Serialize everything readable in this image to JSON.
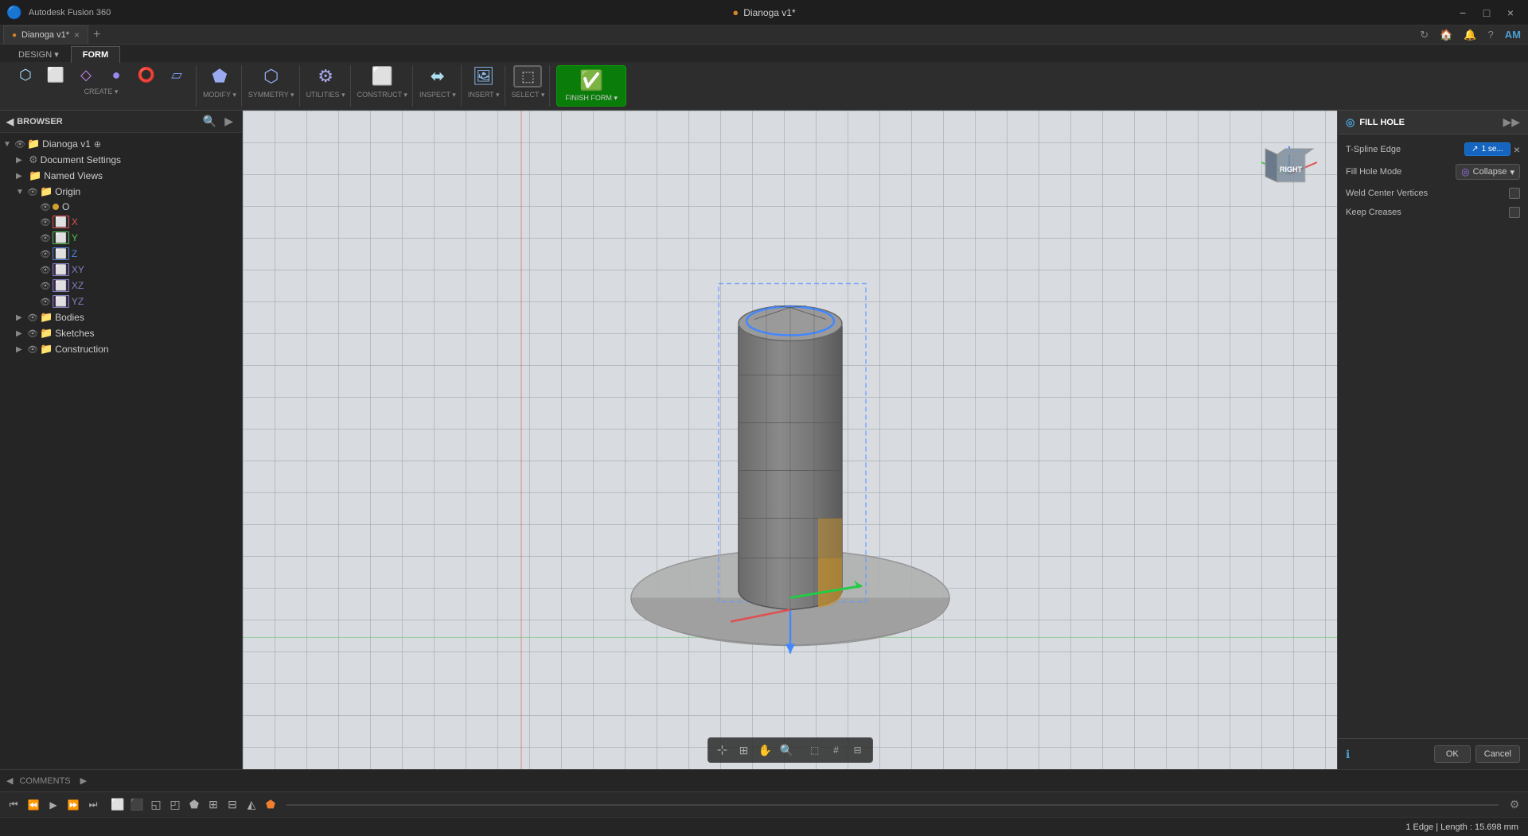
{
  "window": {
    "title": "Dianoga v1*",
    "app": "Autodesk Fusion 360",
    "close_label": "×",
    "minimize_label": "−",
    "maximize_label": "□"
  },
  "toolbar": {
    "active_tab": "FORM",
    "tabs": [
      {
        "id": "design",
        "label": "DESIGN ▾"
      },
      {
        "id": "form",
        "label": "FORM"
      }
    ],
    "sections": [
      {
        "id": "create",
        "items": [
          {
            "id": "create-face",
            "icon": "⬡",
            "label": ""
          },
          {
            "id": "create-box",
            "icon": "⬜",
            "label": ""
          },
          {
            "id": "create-plane",
            "icon": "◇",
            "label": ""
          },
          {
            "id": "create-sphere",
            "icon": "●",
            "label": ""
          },
          {
            "id": "create-cyl",
            "icon": "⭕",
            "label": ""
          },
          {
            "id": "create-wedge",
            "icon": "▱",
            "label": ""
          }
        ],
        "label": "CREATE ▾"
      },
      {
        "id": "modify",
        "label": "MODIFY ▾"
      },
      {
        "id": "symmetry",
        "label": "SYMMETRY ▾"
      },
      {
        "id": "utilities",
        "label": "UTILITIES ▾"
      },
      {
        "id": "construct",
        "label": "CONSTRUCT ▾"
      },
      {
        "id": "inspect",
        "label": "INSPECT ▾"
      },
      {
        "id": "insert",
        "label": "INSERT ▾"
      },
      {
        "id": "select",
        "label": "SELECT ▾"
      },
      {
        "id": "finish_form",
        "label": "FINISH FORM ▾"
      }
    ]
  },
  "browser": {
    "title": "BROWSER",
    "root": "Dianoga v1",
    "items": [
      {
        "id": "doc-settings",
        "label": "Document Settings",
        "indent": 1,
        "type": "settings"
      },
      {
        "id": "named-views",
        "label": "Named Views",
        "indent": 1,
        "type": "folder"
      },
      {
        "id": "origin",
        "label": "Origin",
        "indent": 1,
        "type": "folder"
      },
      {
        "id": "origin-o",
        "label": "O",
        "indent": 2,
        "type": "point"
      },
      {
        "id": "origin-x",
        "label": "X",
        "indent": 2,
        "type": "axis-x"
      },
      {
        "id": "origin-y",
        "label": "Y",
        "indent": 2,
        "type": "axis-y"
      },
      {
        "id": "origin-z",
        "label": "Z",
        "indent": 2,
        "type": "axis-z"
      },
      {
        "id": "origin-xy",
        "label": "XY",
        "indent": 2,
        "type": "plane"
      },
      {
        "id": "origin-xz",
        "label": "XZ",
        "indent": 2,
        "type": "plane"
      },
      {
        "id": "origin-yz",
        "label": "YZ",
        "indent": 2,
        "type": "plane"
      },
      {
        "id": "bodies",
        "label": "Bodies",
        "indent": 1,
        "type": "folder"
      },
      {
        "id": "sketches",
        "label": "Sketches",
        "indent": 1,
        "type": "folder"
      },
      {
        "id": "construction",
        "label": "Construction",
        "indent": 1,
        "type": "folder"
      }
    ]
  },
  "viewport": {
    "status_text": "1 Edge | Length : 15.698 mm"
  },
  "fill_hole": {
    "title": "FILL HOLE",
    "tspline_label": "T-Spline Edge",
    "tspline_value": "1 se...",
    "fill_mode_label": "Fill Hole Mode",
    "fill_mode_value": "Collapse",
    "weld_label": "Weld Center Vertices",
    "keep_label": "Keep Creases",
    "ok_label": "OK",
    "cancel_label": "Cancel"
  },
  "comments": {
    "title": "COMMENTS"
  },
  "bottom_toolbar": {
    "playback": [
      "⏮",
      "⏪",
      "▶",
      "⏩",
      "⏭"
    ]
  },
  "nav_cube": {
    "right_label": "RIGHT"
  }
}
